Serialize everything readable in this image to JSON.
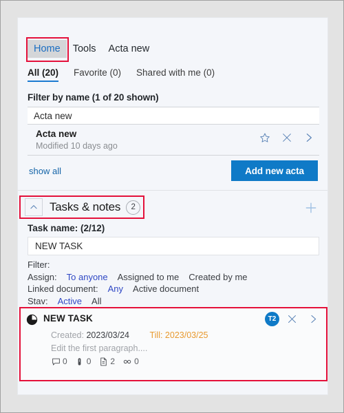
{
  "window": {
    "background": "#e3e3e3",
    "panel_background": "#f4f6fa"
  },
  "colors": {
    "accent_blue": "#0f7ac7",
    "link_blue": "#1565a8",
    "select_purple": "#2f48c4",
    "annotation_red": "#e4103a",
    "due_orange": "#e8992e",
    "icon_blue": "#5a83b6"
  },
  "top_tabs": {
    "items": [
      {
        "label": "Home",
        "active": true
      },
      {
        "label": "Tools",
        "active": false
      },
      {
        "label": "Acta new",
        "active": false
      }
    ]
  },
  "pivots": {
    "items": [
      {
        "label": "All (20)",
        "selected": true
      },
      {
        "label": "Favorite (0)",
        "selected": false
      },
      {
        "label": "Shared with me (0)",
        "selected": false
      }
    ]
  },
  "filter_section": {
    "label": "Filter by name (1 of 20 shown)",
    "input_value": "Acta new",
    "input_placeholder": "Filter by name"
  },
  "acta_row": {
    "title": "Acta new",
    "subtitle": "Modified 10 days ago",
    "icons": {
      "favorite": "star-icon",
      "close": "close-icon",
      "open": "chevron-right-icon"
    }
  },
  "acta_footer": {
    "show_all_label": "show all",
    "add_button_label": "Add new acta"
  },
  "tasks_section": {
    "collapse_icon": "chevron-up-icon",
    "title": "Tasks & notes",
    "count": "2",
    "add_icon": "plus-icon"
  },
  "task_name": {
    "label": "Task name: (2/12)",
    "input_value": "NEW TASK",
    "input_placeholder": "Task name"
  },
  "task_filters": {
    "heading": "Filter:",
    "rows": [
      {
        "label": "Assign:",
        "options": [
          {
            "label": "To anyone",
            "selected": true
          },
          {
            "label": "Assigned to me",
            "selected": false
          },
          {
            "label": "Created by me",
            "selected": false
          }
        ]
      },
      {
        "label": "Linked document:",
        "options": [
          {
            "label": "Any",
            "selected": true
          },
          {
            "label": "Active document",
            "selected": false
          }
        ]
      },
      {
        "label": "Stav:",
        "options": [
          {
            "label": "Active",
            "selected": true
          },
          {
            "label": "All",
            "selected": false
          }
        ]
      }
    ]
  },
  "task_card": {
    "status_icon": "pie-progress-icon",
    "title": "NEW TASK",
    "avatar_initials": "T2",
    "created_label": "Created:",
    "created_value": "2023/03/24",
    "till_text": "Till: 2023/03/25",
    "description": "Edit the first paragraph....",
    "meta": [
      {
        "icon": "comment-icon",
        "value": "0"
      },
      {
        "icon": "attachment-icon",
        "value": "0"
      },
      {
        "icon": "document-icon",
        "value": "2"
      },
      {
        "icon": "link-icon",
        "value": "0"
      }
    ],
    "icons": {
      "close": "close-icon",
      "open": "chevron-right-icon"
    }
  }
}
